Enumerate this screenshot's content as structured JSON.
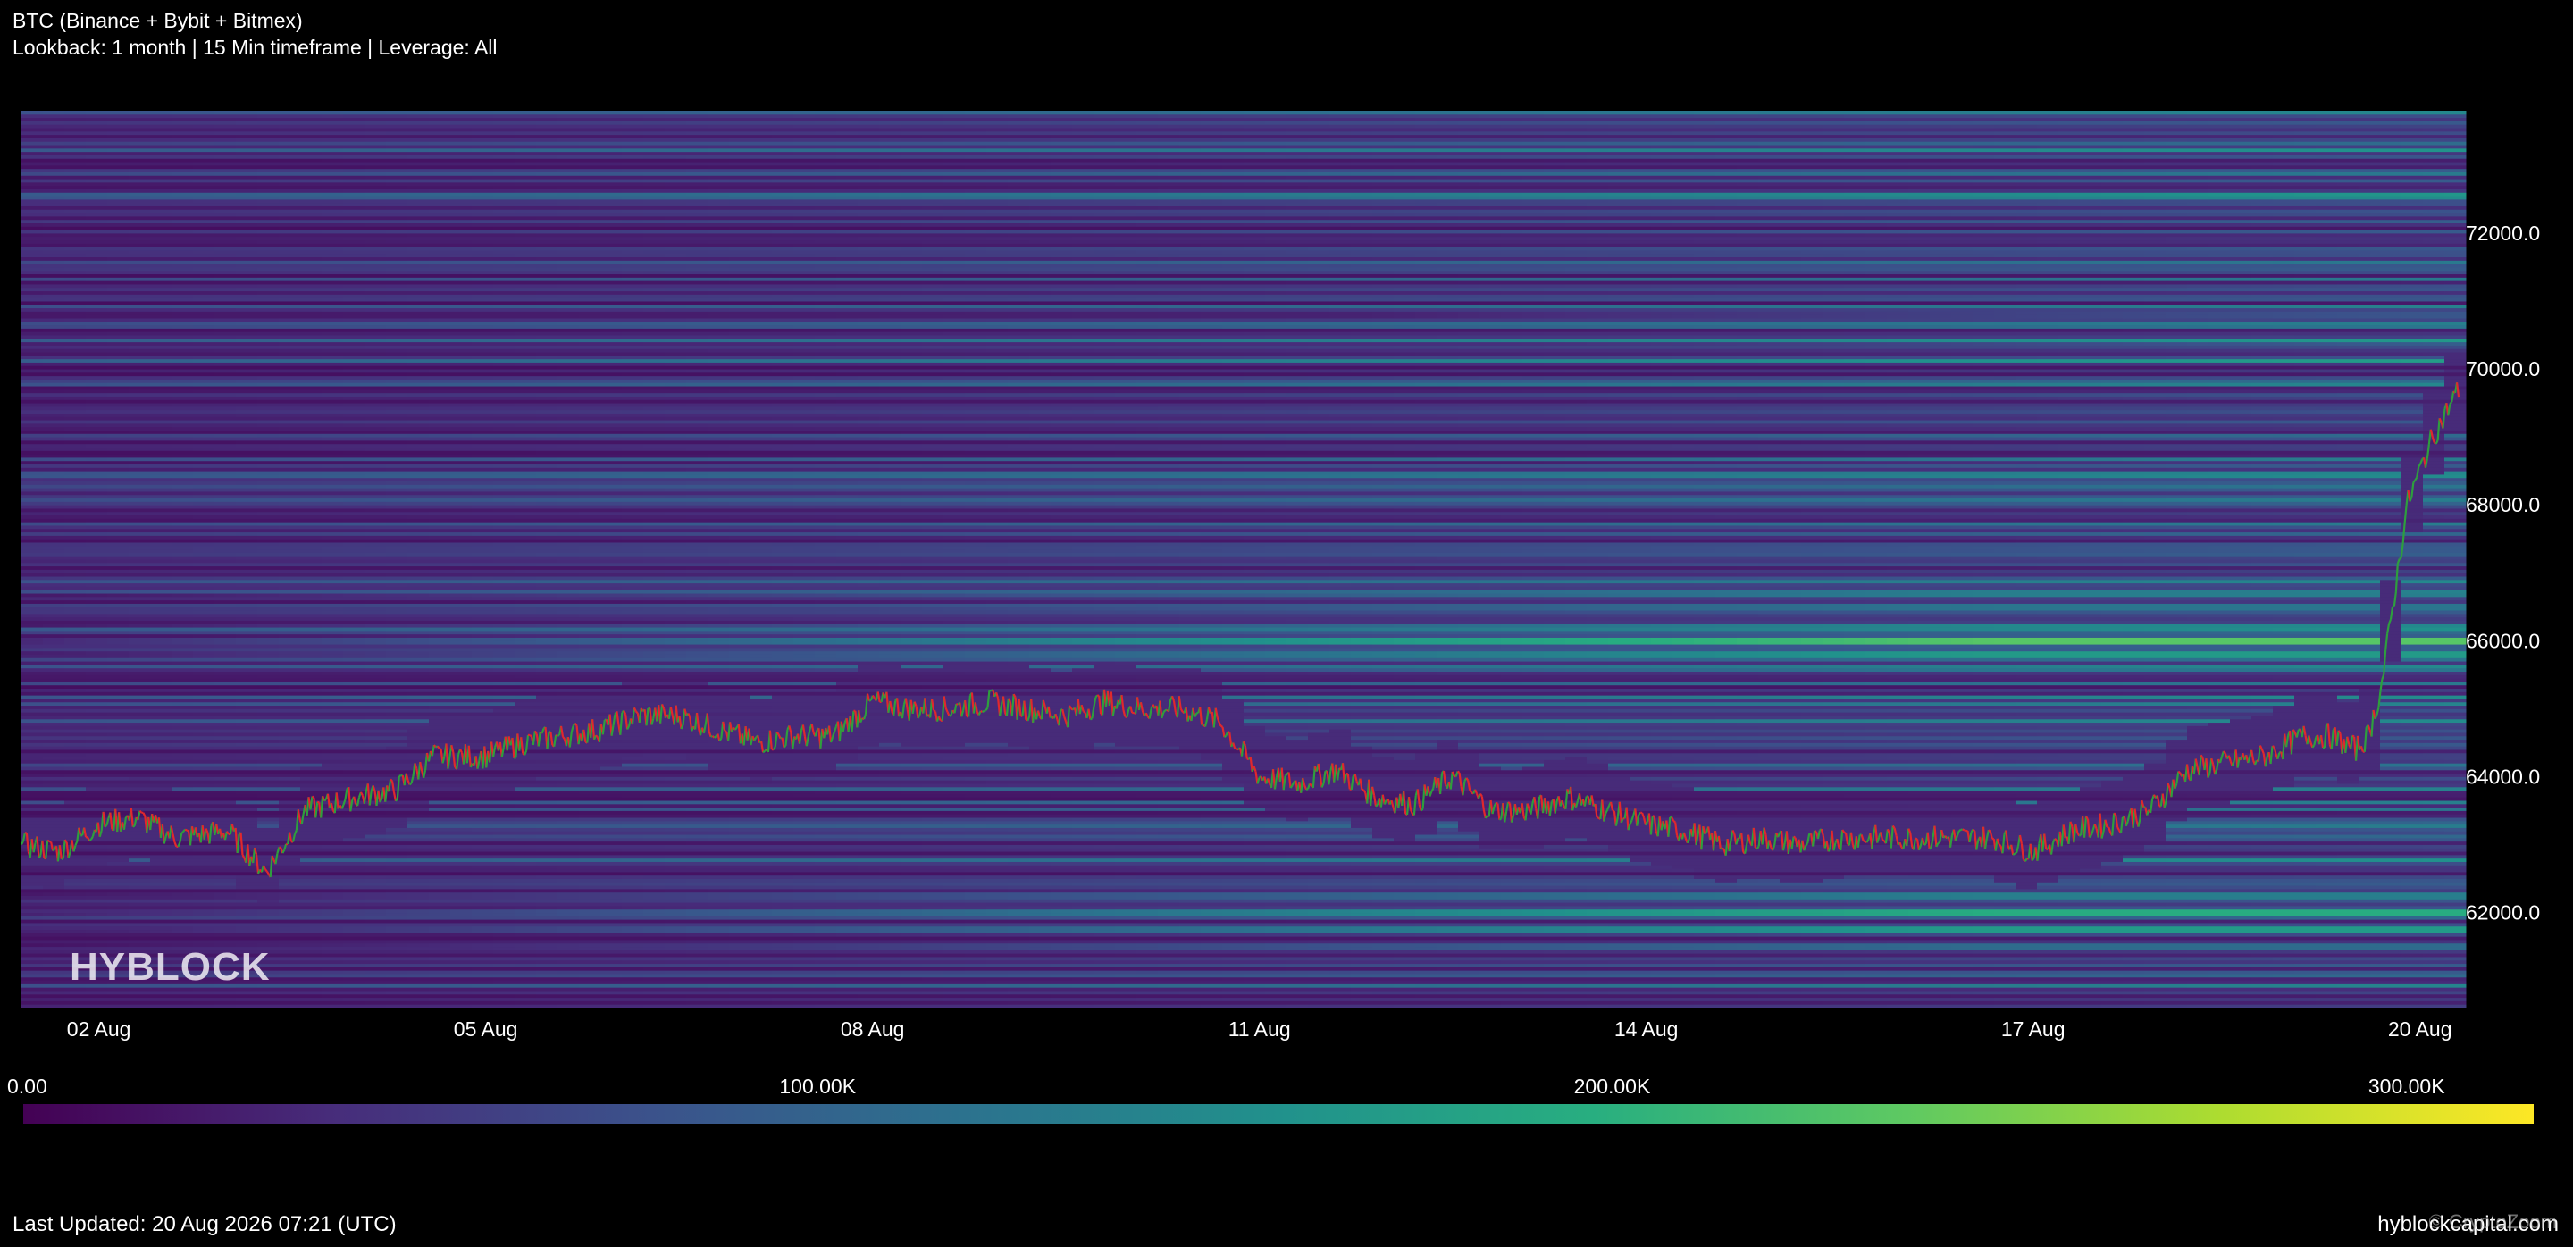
{
  "header": {
    "title": "BTC (Binance + Bybit + Bitmex)",
    "subtitle": "Lookback: 1 month | 15 Min timeframe | Leverage: All"
  },
  "watermark": "HYBLOCK",
  "footer": {
    "last_updated": "Last Updated: 20 Aug 2026 07:21 (UTC)",
    "site": "hyblockcapital.com",
    "overlay": "© CryptoZoom"
  },
  "colors": {
    "background": "#000000",
    "candle_up": "#2e9e3e",
    "candle_down": "#e0282d",
    "colorscale": [
      "#440154",
      "#472d7b",
      "#3b528b",
      "#2c728e",
      "#21918c",
      "#28ae80",
      "#5ec962",
      "#addc30",
      "#fde725"
    ]
  },
  "chart_data": {
    "type": "heatmap",
    "subtype": "liquidation-heatmap-with-price-line",
    "x_ticks": [
      "02 Aug",
      "05 Aug",
      "08 Aug",
      "11 Aug",
      "14 Aug",
      "17 Aug",
      "20 Aug"
    ],
    "x_tick_days": [
      2,
      5,
      8,
      11,
      14,
      17,
      20
    ],
    "x_range_days": [
      1.4,
      20.3
    ],
    "y_ticks": [
      "72000.0",
      "70000.0",
      "68000.0",
      "66000.0",
      "64000.0",
      "62000.0"
    ],
    "y_tick_values": [
      72000,
      70000,
      68000,
      66000,
      64000,
      62000
    ],
    "ylim": [
      60600,
      73800
    ],
    "colorbar": {
      "ticks": [
        "0.00",
        "100.00K",
        "200.00K",
        "300.00K"
      ],
      "tick_values": [
        0,
        100000,
        200000,
        300000
      ],
      "range": [
        0,
        316000
      ]
    },
    "heat_bands": [
      {
        "price": 66000,
        "peak": 0.95
      },
      {
        "price": 65800,
        "peak": 0.7
      },
      {
        "price": 66200,
        "peak": 0.6
      },
      {
        "price": 65600,
        "peak": 0.5
      },
      {
        "price": 66500,
        "peak": 0.5
      },
      {
        "price": 66700,
        "peak": 0.55
      },
      {
        "price": 62000,
        "peak": 0.8
      },
      {
        "price": 61750,
        "peak": 0.7
      },
      {
        "price": 62250,
        "peak": 0.55
      },
      {
        "price": 61500,
        "peak": 0.45
      },
      {
        "price": 70800,
        "peak": 0.45
      },
      {
        "price": 70400,
        "peak": 0.5
      },
      {
        "price": 71200,
        "peak": 0.4
      },
      {
        "price": 69600,
        "peak": 0.35
      },
      {
        "price": 68600,
        "peak": 0.3
      }
    ],
    "price_series": {
      "day": [
        1.4,
        1.7,
        2.0,
        2.3,
        2.6,
        3.0,
        3.3,
        3.6,
        4.0,
        4.3,
        4.6,
        5.0,
        5.3,
        5.6,
        5.9,
        6.2,
        6.5,
        6.8,
        7.1,
        7.4,
        7.7,
        8.0,
        8.3,
        8.6,
        8.9,
        9.2,
        9.5,
        9.8,
        10.1,
        10.4,
        10.7,
        11.0,
        11.3,
        11.6,
        11.9,
        12.2,
        12.5,
        12.8,
        13.1,
        13.4,
        13.7,
        14.0,
        14.3,
        14.6,
        14.9,
        15.2,
        15.5,
        15.8,
        16.1,
        16.4,
        16.7,
        17.0,
        17.3,
        17.6,
        17.9,
        18.2,
        18.5,
        18.8,
        19.1,
        19.3,
        19.5,
        19.6,
        19.7,
        19.9,
        20.1,
        20.3
      ],
      "price": [
        63000,
        62900,
        63300,
        63400,
        63100,
        63200,
        62600,
        63500,
        63700,
        63800,
        64300,
        64300,
        64500,
        64600,
        64700,
        64900,
        64900,
        64700,
        64500,
        64600,
        64600,
        65100,
        65000,
        65000,
        65100,
        65000,
        64900,
        65100,
        65000,
        65000,
        64800,
        64000,
        63900,
        64100,
        63700,
        63600,
        64000,
        63500,
        63500,
        63700,
        63500,
        63300,
        63200,
        63000,
        63100,
        63000,
        63100,
        63100,
        63100,
        63100,
        63100,
        62900,
        63200,
        63300,
        63500,
        64100,
        64200,
        64300,
        64600,
        64600,
        64400,
        64600,
        65300,
        68000,
        69000,
        69700
      ]
    }
  }
}
